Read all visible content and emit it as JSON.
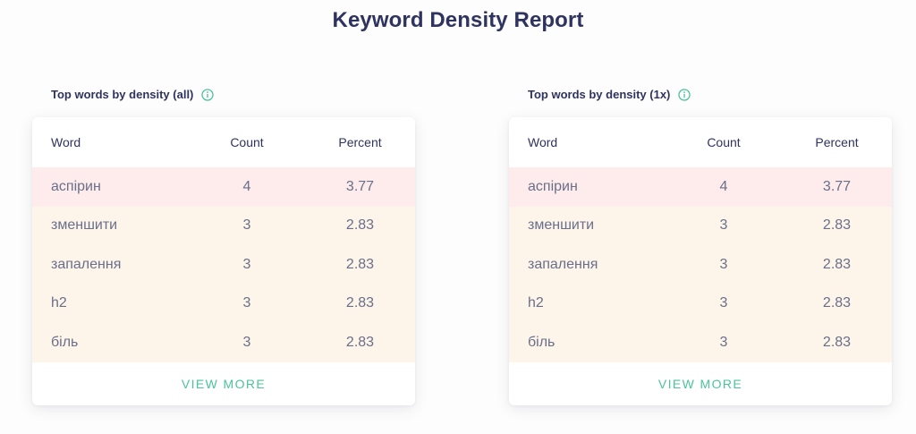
{
  "page": {
    "title": "Keyword Density Report"
  },
  "colors": {
    "accent": "#4cc39a",
    "top_row": "#fdeceb",
    "row": "#fdf4ea",
    "heading": "#2e3360"
  },
  "panels": [
    {
      "heading": "Top words by density (all)",
      "icon": "info-icon",
      "columns": {
        "word": "Word",
        "count": "Count",
        "percent": "Percent"
      },
      "rows": [
        {
          "word": "аспірин",
          "count": "4",
          "percent": "3.77"
        },
        {
          "word": "зменшити",
          "count": "3",
          "percent": "2.83"
        },
        {
          "word": "запалення",
          "count": "3",
          "percent": "2.83"
        },
        {
          "word": "h2",
          "count": "3",
          "percent": "2.83"
        },
        {
          "word": "біль",
          "count": "3",
          "percent": "2.83"
        }
      ],
      "view_more": "VIEW MORE"
    },
    {
      "heading": "Top words by density (1x)",
      "icon": "info-icon",
      "columns": {
        "word": "Word",
        "count": "Count",
        "percent": "Percent"
      },
      "rows": [
        {
          "word": "аспірин",
          "count": "4",
          "percent": "3.77"
        },
        {
          "word": "зменшити",
          "count": "3",
          "percent": "2.83"
        },
        {
          "word": "запалення",
          "count": "3",
          "percent": "2.83"
        },
        {
          "word": "h2",
          "count": "3",
          "percent": "2.83"
        },
        {
          "word": "біль",
          "count": "3",
          "percent": "2.83"
        }
      ],
      "view_more": "VIEW MORE"
    }
  ]
}
